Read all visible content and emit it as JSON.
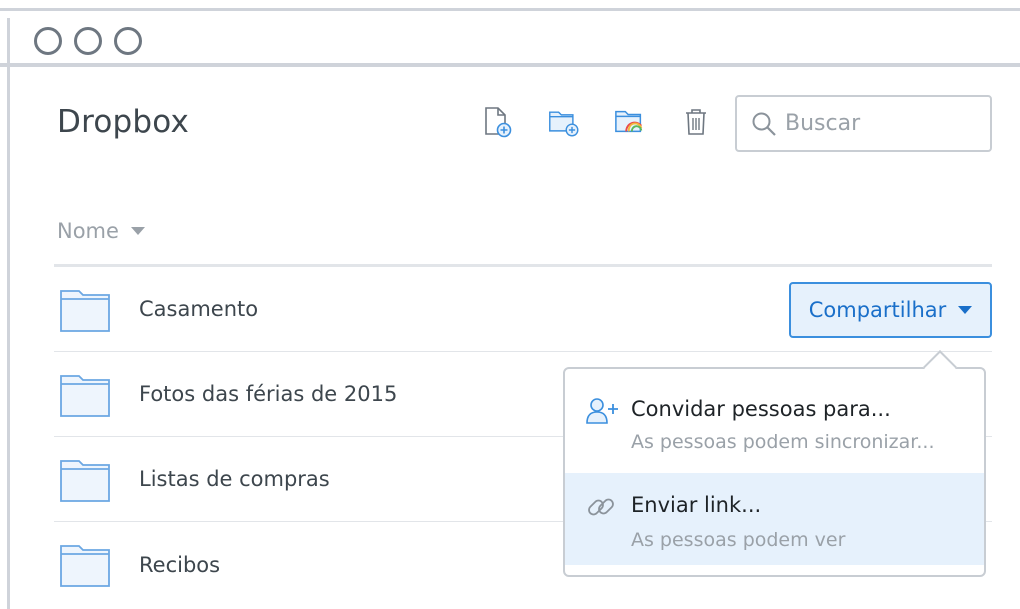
{
  "app": {
    "title": "Dropbox"
  },
  "toolbar": {
    "items": [
      {
        "icon": "new-file-icon"
      },
      {
        "icon": "new-folder-icon"
      },
      {
        "icon": "photo-folder-icon"
      },
      {
        "icon": "trash-icon"
      }
    ]
  },
  "search": {
    "placeholder": "Buscar",
    "value": ""
  },
  "list": {
    "column_header": "Nome",
    "rows": [
      {
        "label": "Casamento"
      },
      {
        "label": "Fotos das férias de 2015"
      },
      {
        "label": "Listas de compras"
      },
      {
        "label": "Recibos"
      }
    ]
  },
  "share_button": {
    "label": "Compartilhar"
  },
  "share_menu": {
    "items": [
      {
        "title": "Convidar pessoas para...",
        "subtitle": "As pessoas podem sincronizar...",
        "icon": "add-person-icon"
      },
      {
        "title": "Enviar link...",
        "subtitle": "As pessoas podem ver",
        "icon": "link-icon"
      }
    ]
  },
  "colors": {
    "accent": "#3b8fde",
    "accent_bg": "#e6f1fc",
    "text": "#3d464d",
    "muted": "#9aa1a8",
    "border": "#c8cdd3"
  }
}
